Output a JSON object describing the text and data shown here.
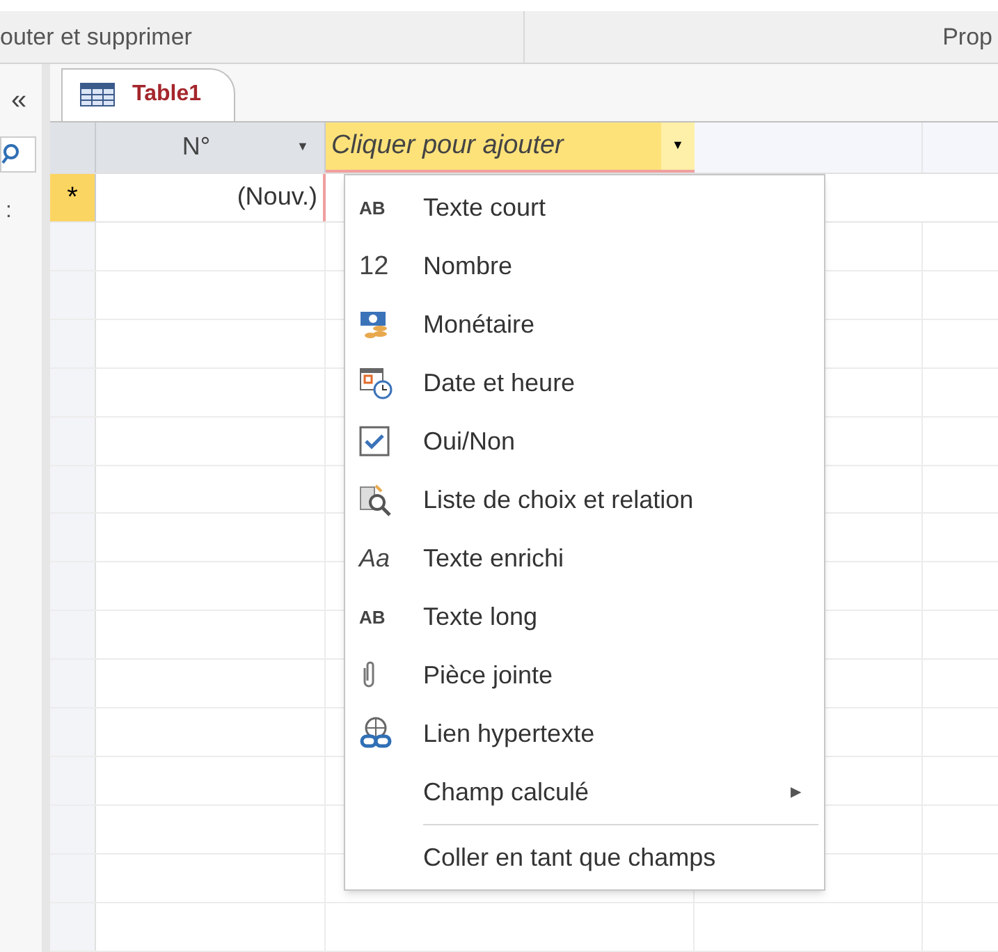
{
  "ribbon": {
    "group_left": "outer et supprimer",
    "group_right": "Prop"
  },
  "nav_pane": {
    "collapse": "«",
    "more": ":"
  },
  "tabs": [
    {
      "label": "Table1",
      "selected": true
    }
  ],
  "table": {
    "columns": [
      {
        "label": "N°",
        "kind": "field",
        "arrow": "▼"
      },
      {
        "label": "Cliquer pour ajouter",
        "kind": "add",
        "arrow": "▼"
      }
    ],
    "new_row": {
      "marker": "*",
      "value": "(Nouv.)"
    }
  },
  "menu": {
    "items": [
      {
        "label": "Texte court",
        "icon": {
          "kind": "bold_text",
          "text": "AB"
        }
      },
      {
        "label": "Nombre",
        "icon": {
          "kind": "large_text",
          "text": "12"
        }
      },
      {
        "label": "Monétaire",
        "icon": {
          "kind": "money"
        }
      },
      {
        "label": "Date et heure",
        "icon": {
          "kind": "datetime"
        }
      },
      {
        "label": "Oui/Non",
        "icon": {
          "kind": "check"
        }
      },
      {
        "label": "Liste de choix et relation",
        "icon": {
          "kind": "lookup"
        }
      },
      {
        "label": "Texte enrichi",
        "icon": {
          "kind": "italic_text",
          "text": "Aa"
        }
      },
      {
        "label": "Texte long",
        "icon": {
          "kind": "bold_text",
          "text": "AB"
        }
      },
      {
        "label": "Pièce jointe",
        "icon": {
          "kind": "clip"
        }
      },
      {
        "label": "Lien hypertexte",
        "icon": {
          "kind": "link"
        }
      },
      {
        "label": "Champ calculé",
        "submenu": true,
        "arrow": "▶"
      },
      {
        "label": "Coller en tant que champs",
        "separator_before": true
      }
    ]
  }
}
